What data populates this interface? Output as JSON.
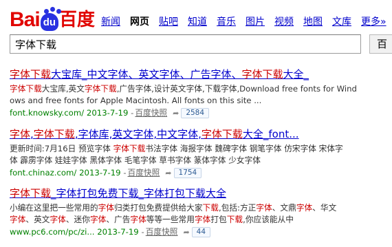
{
  "logo": {
    "text_bai": "Bai",
    "text_du": "du",
    "text_cn": "百度"
  },
  "nav": [
    "新闻",
    "网页",
    "贴吧",
    "知道",
    "音乐",
    "图片",
    "视频",
    "地图",
    "文库",
    "更多»"
  ],
  "search": {
    "value": "字体下载",
    "button_label": "百"
  },
  "results": [
    {
      "title": [
        {
          "t": "字体下载",
          "em": true
        },
        {
          "t": "大宝库_中文字体、英文字体、广告字体、"
        },
        {
          "t": "字体下载",
          "em": true
        },
        {
          "t": "大全_"
        }
      ],
      "abstract": [
        [
          {
            "t": "字体下载",
            "em": true
          },
          {
            "t": "大宝库,英文"
          },
          {
            "t": "字体下载",
            "em": true
          },
          {
            "t": ",广告字体,设计英文字体,下载字体,Download free fonts for Wind"
          }
        ],
        [
          {
            "t": "ows and free fonts for Apple Macintosh. All fonts on this site ..."
          }
        ]
      ],
      "url": "font.knowsky.com/",
      "date": "2013-7-19",
      "sep": "-",
      "snapshot": "百度快照",
      "count": "2584"
    },
    {
      "title": [
        {
          "t": "字体",
          "em": true
        },
        {
          "t": ","
        },
        {
          "t": "字体下载",
          "em": true
        },
        {
          "t": ",字体库,英文字体,中文字体,"
        },
        {
          "t": "字体下载",
          "em": true
        },
        {
          "t": "大全_font..."
        }
      ],
      "abstract": [
        [
          {
            "t": "更新时间:7月16日 预览字体 "
          },
          {
            "t": "字体下载",
            "em": true
          },
          {
            "t": "书法字体 海报字体 魏碑字体 钢笔字体 仿宋字体 宋体字"
          }
        ],
        [
          {
            "t": "体 霹雳字体 娃娃字体 黑体字体 毛笔字体 草书字体 篆体字体 少女字体"
          }
        ]
      ],
      "url": "font.chinaz.com/",
      "date": "2013-7-19",
      "sep": "-",
      "snapshot": "百度快照",
      "count": "1754"
    },
    {
      "title": [
        {
          "t": "字体下载",
          "em": true
        },
        {
          "t": "_字体打包免费下载_字体打包下载大全"
        }
      ],
      "abstract": [
        [
          {
            "t": "小编在这里把一些常用的"
          },
          {
            "t": "字体",
            "em": true
          },
          {
            "t": "归类打包免费提供给大家"
          },
          {
            "t": "下载",
            "em": true
          },
          {
            "t": ",包括:方正"
          },
          {
            "t": "字体",
            "em": true
          },
          {
            "t": "、文鼎"
          },
          {
            "t": "字体",
            "em": true
          },
          {
            "t": "、华文"
          }
        ],
        [
          {
            "t": "字体",
            "em": true
          },
          {
            "t": "、英文"
          },
          {
            "t": "字体",
            "em": true
          },
          {
            "t": "、迷你"
          },
          {
            "t": "字体",
            "em": true
          },
          {
            "t": "、广告"
          },
          {
            "t": "字体",
            "em": true
          },
          {
            "t": "等等一些常用"
          },
          {
            "t": "字体",
            "em": true
          },
          {
            "t": "打包"
          },
          {
            "t": "下载",
            "em": true
          },
          {
            "t": ",你应该能从中"
          }
        ]
      ],
      "url": "www.pc6.com/pc/zi...",
      "date": "2013-7-19",
      "sep": "-",
      "snapshot": "百度快照",
      "count": "44"
    }
  ]
}
